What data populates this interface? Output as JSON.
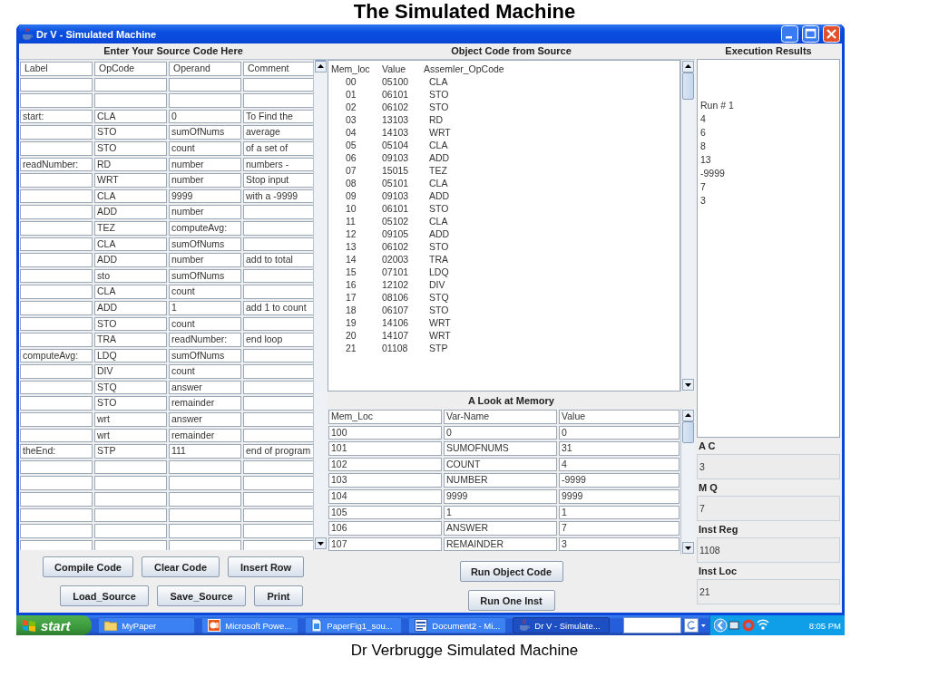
{
  "slide_title": "The Simulated Machine",
  "window": {
    "title": "Dr V - Simulated Machine"
  },
  "source": {
    "heading": "Enter Your  Source Code  Here",
    "columns": [
      "Label",
      "OpCode",
      "Operand",
      "Comment"
    ],
    "rows": [
      {},
      {},
      {
        "label": "start:",
        "opcode": "CLA",
        "operand": "0",
        "comment": "To Find the"
      },
      {
        "opcode": "STO",
        "operand": "sumOfNums",
        "comment": "average"
      },
      {
        "opcode": "STO",
        "operand": "count",
        "comment": "of a set of"
      },
      {
        "label": "readNumber:",
        "opcode": "RD",
        "operand": "number",
        "comment": "numbers -"
      },
      {
        "opcode": "WRT",
        "operand": "number",
        "comment": "Stop input"
      },
      {
        "opcode": "CLA",
        "operand": "9999",
        "comment": "with a -9999"
      },
      {
        "opcode": "ADD",
        "operand": "number"
      },
      {
        "opcode": "TEZ",
        "operand": "computeAvg:"
      },
      {
        "opcode": "CLA",
        "operand": "sumOfNums"
      },
      {
        "opcode": "ADD",
        "operand": "number",
        "comment": "add to total"
      },
      {
        "opcode": "sto",
        "operand": "sumOfNums"
      },
      {
        "opcode": "CLA",
        "operand": "count"
      },
      {
        "opcode": "ADD",
        "operand": "1",
        "comment": "add 1 to count"
      },
      {
        "opcode": "STO",
        "operand": "count"
      },
      {
        "opcode": "TRA",
        "operand": "readNumber:",
        "comment": "end loop"
      },
      {
        "label": "computeAvg:",
        "opcode": "LDQ",
        "operand": "sumOfNums"
      },
      {
        "opcode": "DIV",
        "operand": "count"
      },
      {
        "opcode": "STQ",
        "operand": "answer"
      },
      {
        "opcode": "STO",
        "operand": "remainder"
      },
      {
        "opcode": "wrt",
        "operand": "answer"
      },
      {
        "opcode": "wrt",
        "operand": "remainder"
      },
      {
        "label": "theEnd:",
        "opcode": "STP",
        "operand": "111",
        "comment": "end of program"
      },
      {},
      {},
      {},
      {},
      {},
      {}
    ]
  },
  "source_buttons": [
    [
      "Compile Code",
      "Clear Code",
      "Insert Row"
    ],
    [
      "Load_Source",
      "Save_Source",
      "Print"
    ]
  ],
  "object_code": {
    "heading": "Object Code from Source",
    "columns": [
      "Mem_loc",
      "Value",
      "Assemler_OpCode"
    ],
    "rows": [
      [
        "00",
        "05100",
        "CLA"
      ],
      [
        "01",
        "06101",
        "STO"
      ],
      [
        "02",
        "06102",
        "STO"
      ],
      [
        "03",
        "13103",
        "RD"
      ],
      [
        "04",
        "14103",
        "WRT"
      ],
      [
        "05",
        "05104",
        "CLA"
      ],
      [
        "06",
        "09103",
        "ADD"
      ],
      [
        "07",
        "15015",
        "TEZ"
      ],
      [
        "08",
        "05101",
        "CLA"
      ],
      [
        "09",
        "09103",
        "ADD"
      ],
      [
        "10",
        "06101",
        "STO"
      ],
      [
        "11",
        "05102",
        "CLA"
      ],
      [
        "12",
        "09105",
        "ADD"
      ],
      [
        "13",
        "06102",
        "STO"
      ],
      [
        "14",
        "02003",
        "TRA"
      ],
      [
        "15",
        "07101",
        "LDQ"
      ],
      [
        "16",
        "12102",
        "DIV"
      ],
      [
        "17",
        "08106",
        "STQ"
      ],
      [
        "18",
        "06107",
        "STO"
      ],
      [
        "19",
        "14106",
        "WRT"
      ],
      [
        "20",
        "14107",
        "WRT"
      ],
      [
        "21",
        "01108",
        "STP"
      ]
    ]
  },
  "memory": {
    "heading": "A Look at Memory",
    "columns": [
      "Mem_Loc",
      "Var-Name",
      "Value"
    ],
    "rows": [
      [
        "100",
        "0",
        "0"
      ],
      [
        "101",
        "SUMOFNUMS",
        "31"
      ],
      [
        "102",
        "COUNT",
        "4"
      ],
      [
        "103",
        "NUMBER",
        "-9999"
      ],
      [
        "104",
        "9999",
        "9999"
      ],
      [
        "105",
        "1",
        "1"
      ],
      [
        "106",
        "ANSWER",
        "7"
      ],
      [
        "107",
        "REMAINDER",
        "3"
      ]
    ]
  },
  "run_buttons": [
    "Run Object Code",
    "Run One Inst"
  ],
  "results": {
    "heading": "Execution Results",
    "lines": [
      "Run # 1",
      "4",
      "6",
      "8",
      "13",
      "-9999",
      "7",
      "3"
    ]
  },
  "registers": [
    {
      "label": "A C",
      "value": "3"
    },
    {
      "label": "M Q",
      "value": "7"
    },
    {
      "label": "Inst Reg",
      "value": "1108"
    },
    {
      "label": "Inst Loc",
      "value": "21"
    }
  ],
  "taskbar": {
    "start": "start",
    "items": [
      {
        "label": "MyPaper",
        "kind": "folder",
        "selected": false
      },
      {
        "label": "Microsoft Powe...",
        "kind": "slides",
        "selected": false
      },
      {
        "label": "PaperFig1_sou...",
        "kind": "file",
        "selected": false
      },
      {
        "label": "Document2 - Mi...",
        "kind": "doc",
        "selected": false
      },
      {
        "label": "Dr V - Simulate...",
        "kind": "java",
        "selected": true
      }
    ],
    "clock": "8:05 PM"
  },
  "caption": "Dr Verbrugge Simulated Machine"
}
